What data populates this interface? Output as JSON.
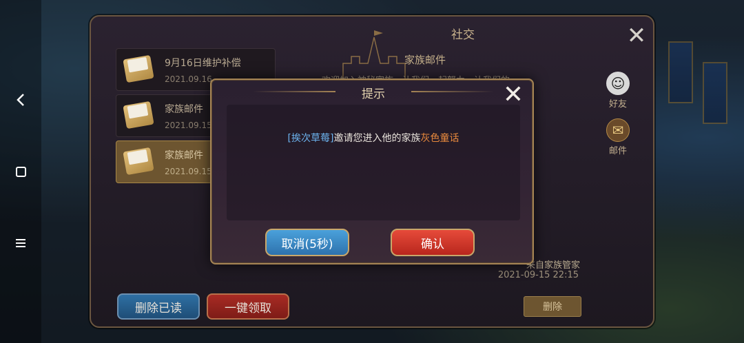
{
  "panel": {
    "title": "社交",
    "mails": [
      {
        "title": "9月16日维护补偿",
        "date": "2021.09.16"
      },
      {
        "title": "家族邮件",
        "date": "2021.09.15"
      },
      {
        "title": "家族邮件",
        "date": "2021.09.15"
      }
    ],
    "detail": {
      "title": "家族邮件",
      "body": "欢迎加入神秘家族，让我们一起努力，让我们的",
      "sender": "来自家族管家",
      "time": "2021-09-15  22:15"
    },
    "side_tabs": {
      "friends": "好友",
      "mail": "邮件"
    },
    "buttons": {
      "delete_read": "删除已读",
      "claim_all": "一键领取",
      "delete": "删除"
    }
  },
  "modal": {
    "title": "提示",
    "inviter": "[挨次草莓]",
    "message": "邀请您进入他的家族",
    "family": "灰色童话",
    "cancel_label": "取消(5秒)",
    "confirm_label": "确认"
  },
  "sysnav": {
    "back_icon": "chevron-left-icon",
    "home_icon": "square-icon",
    "menu_icon": "menu-icon"
  },
  "colors": {
    "inviter_name": "#6cb3ee",
    "family_name": "#e98a3d",
    "cancel_button": "#3a8ac6",
    "confirm_button": "#d23a2c"
  }
}
